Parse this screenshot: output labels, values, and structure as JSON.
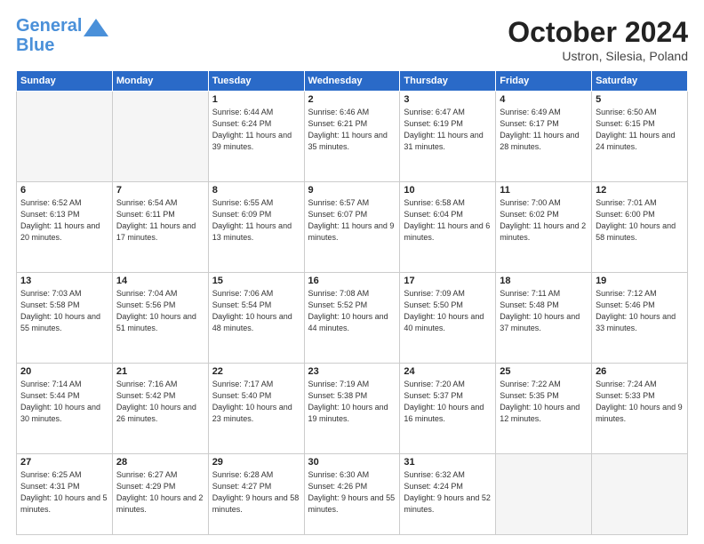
{
  "logo": {
    "line1": "General",
    "line2": "Blue"
  },
  "title": "October 2024",
  "subtitle": "Ustron, Silesia, Poland",
  "headers": [
    "Sunday",
    "Monday",
    "Tuesday",
    "Wednesday",
    "Thursday",
    "Friday",
    "Saturday"
  ],
  "weeks": [
    [
      {
        "day": "",
        "info": ""
      },
      {
        "day": "",
        "info": ""
      },
      {
        "day": "1",
        "info": "Sunrise: 6:44 AM\nSunset: 6:24 PM\nDaylight: 11 hours\nand 39 minutes."
      },
      {
        "day": "2",
        "info": "Sunrise: 6:46 AM\nSunset: 6:21 PM\nDaylight: 11 hours\nand 35 minutes."
      },
      {
        "day": "3",
        "info": "Sunrise: 6:47 AM\nSunset: 6:19 PM\nDaylight: 11 hours\nand 31 minutes."
      },
      {
        "day": "4",
        "info": "Sunrise: 6:49 AM\nSunset: 6:17 PM\nDaylight: 11 hours\nand 28 minutes."
      },
      {
        "day": "5",
        "info": "Sunrise: 6:50 AM\nSunset: 6:15 PM\nDaylight: 11 hours\nand 24 minutes."
      }
    ],
    [
      {
        "day": "6",
        "info": "Sunrise: 6:52 AM\nSunset: 6:13 PM\nDaylight: 11 hours\nand 20 minutes."
      },
      {
        "day": "7",
        "info": "Sunrise: 6:54 AM\nSunset: 6:11 PM\nDaylight: 11 hours\nand 17 minutes."
      },
      {
        "day": "8",
        "info": "Sunrise: 6:55 AM\nSunset: 6:09 PM\nDaylight: 11 hours\nand 13 minutes."
      },
      {
        "day": "9",
        "info": "Sunrise: 6:57 AM\nSunset: 6:07 PM\nDaylight: 11 hours\nand 9 minutes."
      },
      {
        "day": "10",
        "info": "Sunrise: 6:58 AM\nSunset: 6:04 PM\nDaylight: 11 hours\nand 6 minutes."
      },
      {
        "day": "11",
        "info": "Sunrise: 7:00 AM\nSunset: 6:02 PM\nDaylight: 11 hours\nand 2 minutes."
      },
      {
        "day": "12",
        "info": "Sunrise: 7:01 AM\nSunset: 6:00 PM\nDaylight: 10 hours\nand 58 minutes."
      }
    ],
    [
      {
        "day": "13",
        "info": "Sunrise: 7:03 AM\nSunset: 5:58 PM\nDaylight: 10 hours\nand 55 minutes."
      },
      {
        "day": "14",
        "info": "Sunrise: 7:04 AM\nSunset: 5:56 PM\nDaylight: 10 hours\nand 51 minutes."
      },
      {
        "day": "15",
        "info": "Sunrise: 7:06 AM\nSunset: 5:54 PM\nDaylight: 10 hours\nand 48 minutes."
      },
      {
        "day": "16",
        "info": "Sunrise: 7:08 AM\nSunset: 5:52 PM\nDaylight: 10 hours\nand 44 minutes."
      },
      {
        "day": "17",
        "info": "Sunrise: 7:09 AM\nSunset: 5:50 PM\nDaylight: 10 hours\nand 40 minutes."
      },
      {
        "day": "18",
        "info": "Sunrise: 7:11 AM\nSunset: 5:48 PM\nDaylight: 10 hours\nand 37 minutes."
      },
      {
        "day": "19",
        "info": "Sunrise: 7:12 AM\nSunset: 5:46 PM\nDaylight: 10 hours\nand 33 minutes."
      }
    ],
    [
      {
        "day": "20",
        "info": "Sunrise: 7:14 AM\nSunset: 5:44 PM\nDaylight: 10 hours\nand 30 minutes."
      },
      {
        "day": "21",
        "info": "Sunrise: 7:16 AM\nSunset: 5:42 PM\nDaylight: 10 hours\nand 26 minutes."
      },
      {
        "day": "22",
        "info": "Sunrise: 7:17 AM\nSunset: 5:40 PM\nDaylight: 10 hours\nand 23 minutes."
      },
      {
        "day": "23",
        "info": "Sunrise: 7:19 AM\nSunset: 5:38 PM\nDaylight: 10 hours\nand 19 minutes."
      },
      {
        "day": "24",
        "info": "Sunrise: 7:20 AM\nSunset: 5:37 PM\nDaylight: 10 hours\nand 16 minutes."
      },
      {
        "day": "25",
        "info": "Sunrise: 7:22 AM\nSunset: 5:35 PM\nDaylight: 10 hours\nand 12 minutes."
      },
      {
        "day": "26",
        "info": "Sunrise: 7:24 AM\nSunset: 5:33 PM\nDaylight: 10 hours\nand 9 minutes."
      }
    ],
    [
      {
        "day": "27",
        "info": "Sunrise: 6:25 AM\nSunset: 4:31 PM\nDaylight: 10 hours\nand 5 minutes."
      },
      {
        "day": "28",
        "info": "Sunrise: 6:27 AM\nSunset: 4:29 PM\nDaylight: 10 hours\nand 2 minutes."
      },
      {
        "day": "29",
        "info": "Sunrise: 6:28 AM\nSunset: 4:27 PM\nDaylight: 9 hours\nand 58 minutes."
      },
      {
        "day": "30",
        "info": "Sunrise: 6:30 AM\nSunset: 4:26 PM\nDaylight: 9 hours\nand 55 minutes."
      },
      {
        "day": "31",
        "info": "Sunrise: 6:32 AM\nSunset: 4:24 PM\nDaylight: 9 hours\nand 52 minutes."
      },
      {
        "day": "",
        "info": ""
      },
      {
        "day": "",
        "info": ""
      }
    ]
  ]
}
